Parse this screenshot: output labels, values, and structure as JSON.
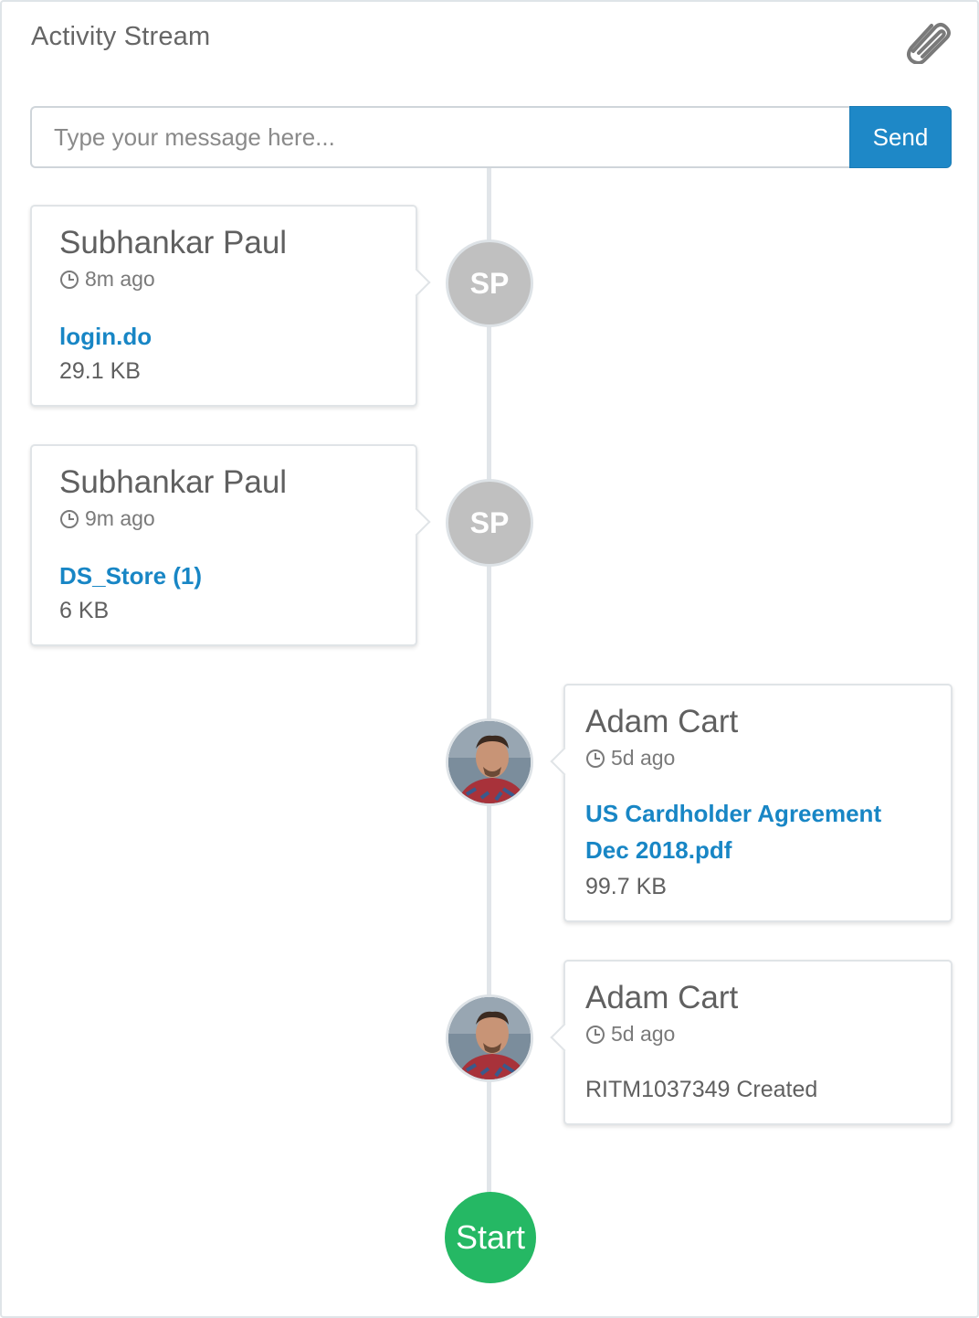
{
  "header": {
    "title": "Activity Stream",
    "attach_icon": "paperclip-icon"
  },
  "composer": {
    "placeholder": "Type your message here...",
    "send_label": "Send"
  },
  "entries": [
    {
      "author": "Subhankar Paul",
      "time": "8m ago",
      "avatar_initials": "SP",
      "attachment_name": "login.do",
      "attachment_size": "29.1 KB"
    },
    {
      "author": "Subhankar Paul",
      "time": "9m ago",
      "avatar_initials": "SP",
      "attachment_name": "DS_Store (1)",
      "attachment_size": "6 KB"
    },
    {
      "author": "Adam Cart",
      "time": "5d ago",
      "avatar": "user-photo",
      "attachment_name_line1": "US Cardholder Agreement",
      "attachment_name_line2": "Dec 2018.pdf",
      "attachment_size": "99.7 KB"
    },
    {
      "author": "Adam Cart",
      "time": "5d ago",
      "avatar": "user-photo",
      "message": "RITM1037349 Created"
    }
  ],
  "timeline_start_label": "Start",
  "colors": {
    "accent": "#1e88c7",
    "link": "#1886c5",
    "start": "#25b864",
    "initials_avatar": "#c0c0c0"
  }
}
